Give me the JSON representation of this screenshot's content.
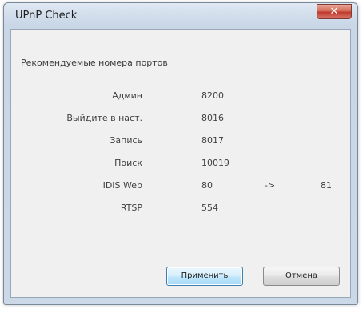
{
  "window": {
    "title": "UPnP Check",
    "close_glyph": "✕"
  },
  "heading": "Рекомендуемые номера портов",
  "ports": [
    {
      "label": "Админ",
      "value": "8200",
      "arrow": "",
      "value2": ""
    },
    {
      "label": "Выйдите в наст.",
      "value": "8016",
      "arrow": "",
      "value2": ""
    },
    {
      "label": "Запись",
      "value": "8017",
      "arrow": "",
      "value2": ""
    },
    {
      "label": "Поиск",
      "value": "10019",
      "arrow": "",
      "value2": ""
    },
    {
      "label": "IDIS Web",
      "value": "80",
      "arrow": "->",
      "value2": "81"
    },
    {
      "label": "RTSP",
      "value": "554",
      "arrow": "",
      "value2": ""
    }
  ],
  "buttons": {
    "apply": "Применить",
    "cancel": "Отмена"
  }
}
